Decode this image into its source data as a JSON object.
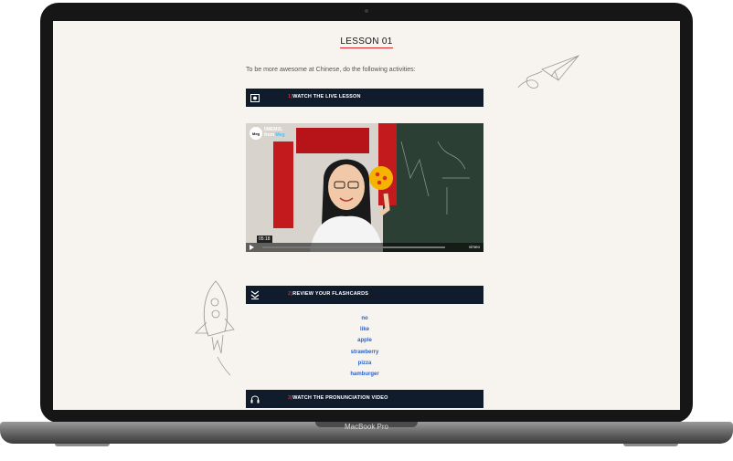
{
  "device": {
    "label": "MacBook Pro"
  },
  "lesson": {
    "title": "LESSON 01",
    "intro": "To be more awesome at Chinese, do the following activities:"
  },
  "sections": [
    {
      "num": "1)",
      "label": "WATCH THE LIVE LESSON",
      "icon": "video-camera-icon"
    },
    {
      "num": "2)",
      "label": "REVIEW YOUR FLASHCARDS",
      "icon": "double-chevron-down-icon"
    },
    {
      "num": "3)",
      "label": "WATCH THE PRONUNCIATION VIDEO",
      "icon": "headphones-icon"
    }
  ],
  "video": {
    "badge": "Meg",
    "title_part": "0MEM2L",
    "from": "from",
    "author": "Meg",
    "duration": "05:18",
    "provider": "vimeo"
  },
  "flashcards": [
    "no",
    "like",
    "apple",
    "strawberry",
    "pizza",
    "hamburger"
  ],
  "colors": {
    "screen_bg": "#f7f3ef",
    "bar_bg": "#101c2b",
    "accent_red": "#e0242c",
    "link_blue": "#2a62c9"
  }
}
